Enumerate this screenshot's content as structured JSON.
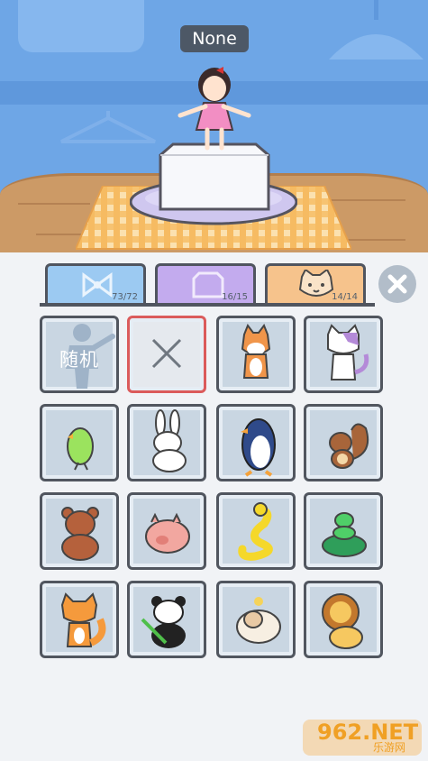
{
  "header": {
    "name_label": "None"
  },
  "tabs": [
    {
      "id": "bow",
      "icon": "bow-icon",
      "count": "73/72",
      "bg": "#9ccaf2"
    },
    {
      "id": "box",
      "icon": "box-icon",
      "count": "16/15",
      "bg": "#c3abee"
    },
    {
      "id": "pet",
      "icon": "cat-face-icon",
      "count": "14/14",
      "bg": "#f6c38c"
    }
  ],
  "grid": {
    "random_label": "随机",
    "items": [
      "random",
      "none",
      "shiba-dog",
      "purple-cat",
      "parrot",
      "rabbit",
      "penguin",
      "squirrel",
      "bear",
      "pig",
      "snake",
      "frog-turtle",
      "fox",
      "panda",
      "sheep",
      "lion"
    ]
  },
  "watermark": {
    "big": "962.NET",
    "small": "乐游网"
  },
  "colors": {
    "accent_selected": "#db5b5b",
    "outline": "#51565f"
  }
}
